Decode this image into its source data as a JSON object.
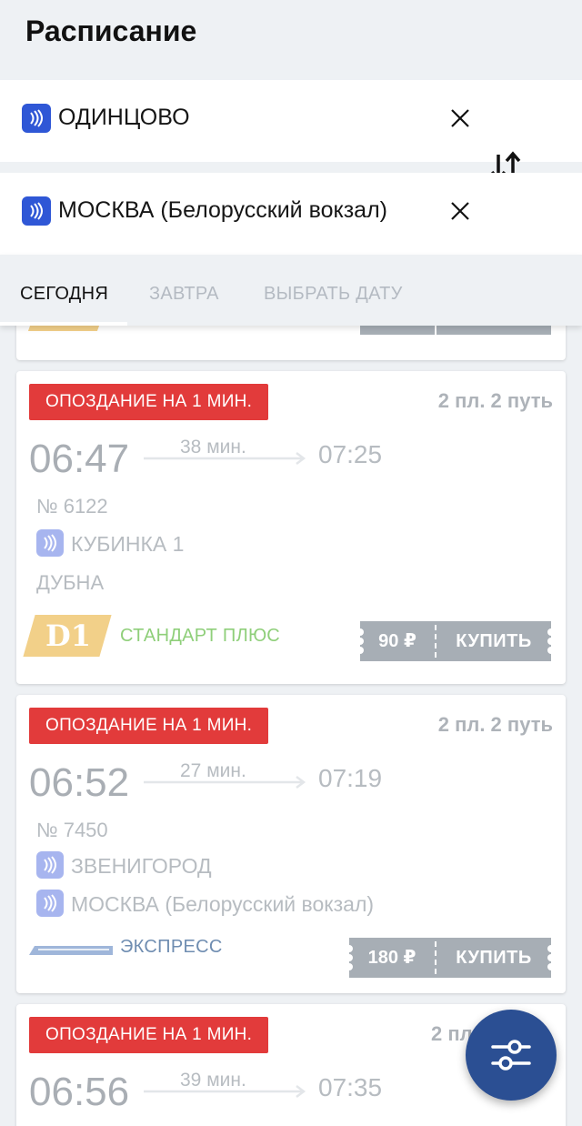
{
  "header": {
    "title": "Расписание"
  },
  "route": {
    "from": {
      "name": "ОДИНЦОВО",
      "icon": "train-station-icon"
    },
    "to": {
      "name": "МОСКВА (Белорусский вокзал)",
      "icon": "train-station-icon"
    },
    "clear_icon": "close-icon",
    "swap_icon": "swap-vertical-icon"
  },
  "tabs": [
    {
      "label": "СЕГОДНЯ",
      "active": true
    },
    {
      "label": "ЗАВТРА",
      "active": false
    },
    {
      "label": "ВЫБРАТЬ ДАТУ",
      "active": false
    }
  ],
  "trains": [
    {
      "status": "ОПОЗДАНИЕ НА 1 МИН.",
      "platform": "2 пл. 2 путь",
      "departure": "06:47",
      "duration": "38 мин.",
      "arrival": "07:25",
      "number": "№ 6122",
      "from_station": "КУБИНКА 1",
      "to_station": "ДУБНА",
      "badge": "D1",
      "type": "СТАНДАРТ ПЛЮС",
      "type_color": "#8fcf7a",
      "price": "90 ₽",
      "buy_label": "КУПИТЬ"
    },
    {
      "status": "ОПОЗДАНИЕ НА 1 МИН.",
      "platform": "2 пл. 2 путь",
      "departure": "06:52",
      "duration": "27 мин.",
      "arrival": "07:19",
      "number": "№ 7450",
      "from_station": "ЗВЕНИГОРОД",
      "to_station": "МОСКВА (Белорусский вокзал)",
      "type": "ЭКСПРЕСС",
      "type_color": "#6f8db1",
      "price": "180 ₽",
      "buy_label": "КУПИТЬ"
    },
    {
      "status": "ОПОЗДАНИЕ НА 1 МИН.",
      "platform": "2 пл",
      "departure": "06:56",
      "duration": "39 мин.",
      "arrival": "07:35"
    }
  ],
  "colors": {
    "accent": "#2b4f93",
    "delay": "#e23b3b",
    "station_icon": "#2f57d6",
    "ticket": "#a7aeb5",
    "d1_badge": "#f2d089"
  },
  "fab": {
    "icon": "filter-sliders-icon"
  }
}
